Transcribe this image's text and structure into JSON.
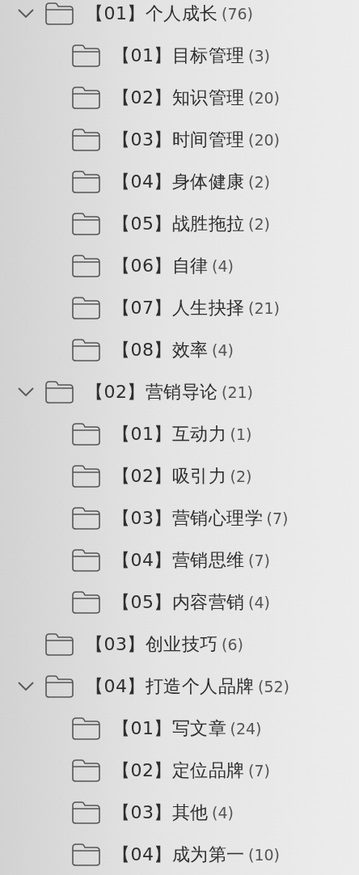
{
  "tree": [
    {
      "label": "【01】个人成长",
      "count": "(76)",
      "expanded": true,
      "children": [
        {
          "label": "【01】目标管理",
          "count": "(3)"
        },
        {
          "label": "【02】知识管理",
          "count": "(20)"
        },
        {
          "label": "【03】时间管理",
          "count": "(20)"
        },
        {
          "label": "【04】身体健康",
          "count": "(2)"
        },
        {
          "label": "【05】战胜拖拉",
          "count": "(2)"
        },
        {
          "label": "【06】自律",
          "count": "(4)"
        },
        {
          "label": "【07】人生抉择",
          "count": "(21)"
        },
        {
          "label": "【08】效率",
          "count": "(4)"
        }
      ]
    },
    {
      "label": "【02】营销导论",
      "count": "(21)",
      "expanded": true,
      "children": [
        {
          "label": "【01】互动力",
          "count": "(1)"
        },
        {
          "label": "【02】吸引力",
          "count": "(2)"
        },
        {
          "label": "【03】营销心理学",
          "count": "(7)"
        },
        {
          "label": "【04】营销思维",
          "count": "(7)"
        },
        {
          "label": "【05】内容营销",
          "count": "(4)"
        }
      ]
    },
    {
      "label": "【03】创业技巧",
      "count": "(6)"
    },
    {
      "label": "【04】打造个人品牌",
      "count": "(52)",
      "expanded": true,
      "children": [
        {
          "label": "【01】写文章",
          "count": "(24)"
        },
        {
          "label": "【02】定位品牌",
          "count": "(7)"
        },
        {
          "label": "【03】其他",
          "count": "(4)"
        },
        {
          "label": "【04】成为第一",
          "count": "(10)"
        }
      ]
    }
  ]
}
